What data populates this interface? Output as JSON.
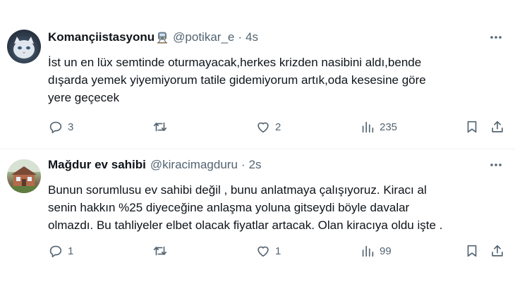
{
  "tweets": [
    {
      "display_name": "Komançiistasyonu",
      "handle": "@potikar_e",
      "separator": "·",
      "time": "4s",
      "avatar_icon": "cat-avatar",
      "name_emoji_icon": "train-icon",
      "text_lines": [
        "İst un en lüx semtinde oturmayacak,herkes krizden nasibini aldı,bende",
        "dışarda yemek yiyemiyorum tatile gidemiyorum artık,oda kesesine göre",
        "yere geçecek"
      ],
      "replies": "3",
      "reposts": "",
      "likes": "2",
      "views": "235"
    },
    {
      "display_name": "Mağdur ev sahibi",
      "handle": "@kiracimagduru",
      "separator": "·",
      "time": "2s",
      "avatar_icon": "house-avatar",
      "text_lines": [
        "Bunun sorumlusu ev sahibi değil , bunu anlatmaya çalışıyoruz. Kiracı al",
        "senin hakkın %25 diyeceğine anlaşma yoluna gitseydi böyle davalar",
        "olmazdı. Bu tahliyeler elbet olacak fiyatlar artacak. Olan kiracıya oldu işte ."
      ],
      "replies": "1",
      "reposts": "",
      "likes": "1",
      "views": "99"
    }
  ],
  "colors": {
    "text_primary": "#0f1419",
    "text_secondary": "#536471",
    "divider": "#eff3f4",
    "background": "#ffffff"
  }
}
